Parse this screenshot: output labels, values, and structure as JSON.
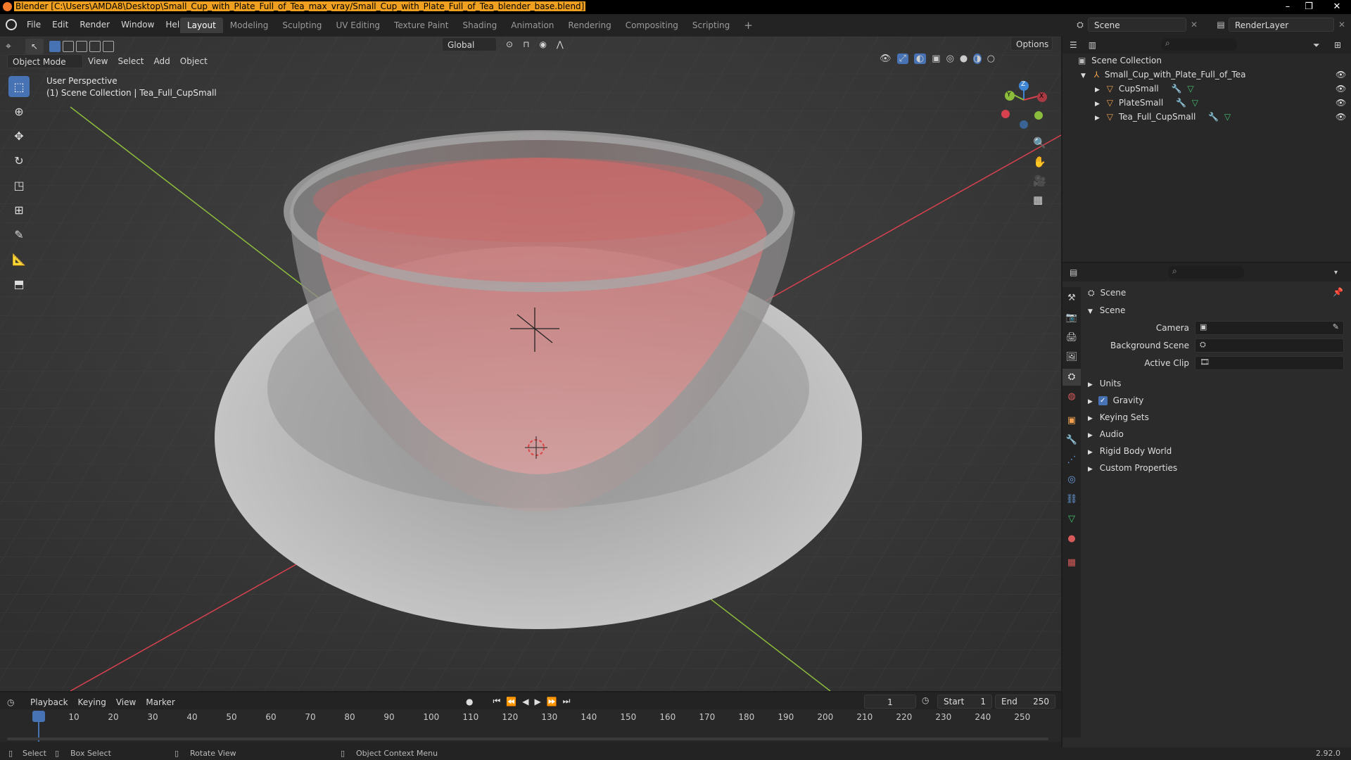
{
  "window": {
    "title": "Blender [C:\\Users\\AMDA8\\Desktop\\Small_Cup_with_Plate_Full_of_Tea_max_vray/Small_Cup_with_Plate_Full_of_Tea_blender_base.blend]",
    "minimize": "–",
    "maximize": "❐",
    "close": "✕"
  },
  "menu": [
    "File",
    "Edit",
    "Render",
    "Window",
    "Help"
  ],
  "workspaces": [
    {
      "label": "Layout",
      "active": true
    },
    {
      "label": "Modeling",
      "active": false
    },
    {
      "label": "Sculpting",
      "active": false
    },
    {
      "label": "UV Editing",
      "active": false
    },
    {
      "label": "Texture Paint",
      "active": false
    },
    {
      "label": "Shading",
      "active": false
    },
    {
      "label": "Animation",
      "active": false
    },
    {
      "label": "Rendering",
      "active": false
    },
    {
      "label": "Compositing",
      "active": false
    },
    {
      "label": "Scripting",
      "active": false
    }
  ],
  "add_workspace": "+",
  "scene_selector": "Scene",
  "render_layer": "RenderLayer",
  "viewport_header": {
    "mode": "Object Mode",
    "view": "View",
    "select": "Select",
    "add": "Add",
    "object": "Object",
    "orientation": "Global",
    "options": "Options"
  },
  "viewport_overlay": {
    "perspective": "User Perspective",
    "collection_info": "(1) Scene Collection | Tea_Full_CupSmall"
  },
  "gizmo": {
    "x": "X",
    "y": "Y",
    "z": "Z"
  },
  "outliner": {
    "root": "Scene Collection",
    "collection": "Small_Cup_with_Plate_Full_of_Tea",
    "objects": [
      "CupSmall",
      "PlateSmall",
      "Tea_Full_CupSmall"
    ]
  },
  "properties": {
    "header": "Scene",
    "panel": "Scene",
    "camera_label": "Camera",
    "background_label": "Background Scene",
    "clip_label": "Active Clip",
    "sections": [
      "Units",
      "Gravity",
      "Keying Sets",
      "Audio",
      "Rigid Body World",
      "Custom Properties"
    ],
    "gravity_checked": true
  },
  "timeline": {
    "playback": "Playback",
    "keying": "Keying",
    "view": "View",
    "marker": "Marker",
    "current_frame": "1",
    "start_label": "Start",
    "start_value": "1",
    "end_label": "End",
    "end_value": "250",
    "ruler": [
      "1",
      "10",
      "20",
      "30",
      "40",
      "50",
      "60",
      "70",
      "80",
      "90",
      "100",
      "110",
      "120",
      "130",
      "140",
      "150",
      "160",
      "170",
      "180",
      "190",
      "200",
      "210",
      "220",
      "230",
      "240",
      "250"
    ]
  },
  "status": {
    "select": "Select",
    "box_select": "Box Select",
    "rotate_view": "Rotate View",
    "context_menu": "Object Context Menu",
    "version": "2.92.0"
  },
  "colors": {
    "accent": "#4772b3",
    "x_axis": "#d6414f",
    "y_axis": "#8cbc3c",
    "z_axis": "#3f86d4"
  }
}
